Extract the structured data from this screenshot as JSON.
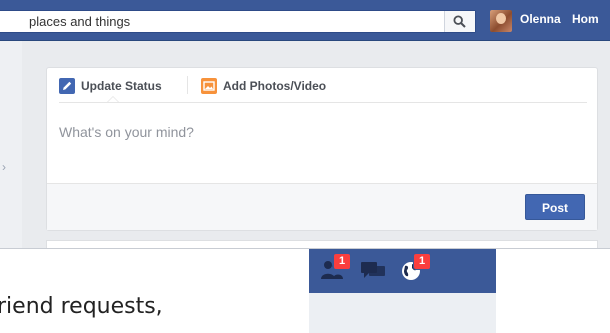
{
  "search": {
    "placeholder_text": "places and things"
  },
  "header": {
    "username": "Olenna",
    "home_label": "Hom"
  },
  "composer": {
    "tab_update_status": "Update Status",
    "tab_add_photos": "Add Photos/Video",
    "prompt": "What's on your mind?",
    "post_label": "Post"
  },
  "caption": {
    "text": "riend requests,"
  },
  "jewels": {
    "friend_requests_count": "1",
    "messages_count": "",
    "notifications_count": "1"
  },
  "colors": {
    "brand_blue": "#3b5998",
    "badge_red": "#fa3e3e",
    "button_blue": "#4267b2"
  },
  "icons": [
    "search-icon",
    "pencil-icon",
    "photo-icon",
    "friend-requests-icon",
    "messages-icon",
    "globe-icon"
  ]
}
